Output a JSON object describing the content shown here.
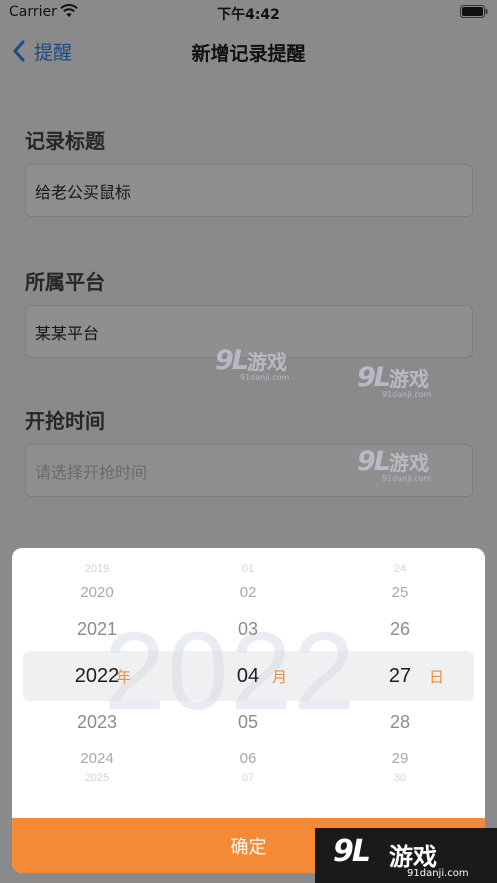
{
  "status_bar": {
    "carrier": "Carrier",
    "time": "下午4:42"
  },
  "nav": {
    "back_label": "提醒",
    "title": "新增记录提醒"
  },
  "form": {
    "record_title": {
      "label": "记录标题",
      "value": "给老公买鼠标"
    },
    "platform": {
      "label": "所属平台",
      "value": "某某平台"
    },
    "start_time": {
      "label": "开抢时间",
      "placeholder": "请选择开抢时间"
    }
  },
  "picker": {
    "background_year": "2022",
    "year": {
      "values": [
        "2019",
        "2020",
        "2021",
        "2022",
        "2023",
        "2024",
        "2025"
      ],
      "unit": "年"
    },
    "month": {
      "values": [
        "01",
        "02",
        "03",
        "04",
        "05",
        "06",
        "07"
      ],
      "unit": "月"
    },
    "day": {
      "values": [
        "24",
        "25",
        "26",
        "27",
        "28",
        "29",
        "30"
      ],
      "unit": "日"
    },
    "confirm_label": "确定"
  },
  "watermark": {
    "mark": "9L",
    "text": "游戏",
    "site": "91danji.com"
  },
  "corner_logo": {
    "mark": "9L",
    "text": "游戏",
    "site": "91danji.com"
  },
  "colors": {
    "accent": "#f58a36",
    "back_link": "#1a4b85",
    "overlay": "#8a8a8a"
  }
}
